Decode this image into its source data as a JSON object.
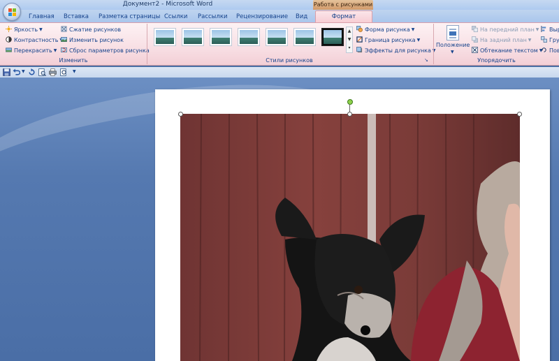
{
  "window": {
    "title": "Документ2 - Microsoft Word",
    "context_tab_group": "Работа с рисунками"
  },
  "tabs": [
    {
      "label": "Главная"
    },
    {
      "label": "Вставка"
    },
    {
      "label": "Разметка страницы"
    },
    {
      "label": "Ссылки"
    },
    {
      "label": "Рассылки"
    },
    {
      "label": "Рецензирование"
    },
    {
      "label": "Вид"
    },
    {
      "label": "Формат",
      "active": true
    }
  ],
  "ribbon": {
    "adjust": {
      "label": "Изменить",
      "brightness": "Яркость",
      "contrast": "Контрастность",
      "recolor": "Перекрасить",
      "compress": "Сжатие рисунков",
      "change": "Изменить рисунок",
      "reset": "Сброс параметров рисунка"
    },
    "styles": {
      "label": "Стили рисунков",
      "shape": "Форма рисунка",
      "border": "Граница рисунка",
      "effects": "Эффекты для рисунка",
      "thumb_count": 7,
      "selected_index": 6
    },
    "arrange": {
      "label": "Упорядочить",
      "position": "Положение",
      "bring_front": "На передний план",
      "send_back": "На задний план",
      "text_wrap": "Обтекание текстом",
      "align_cut": "Выр",
      "group_cut": "Гру",
      "rotate_cut": "Пов"
    }
  },
  "colors": {
    "ribbon_pink": "#f8dfe4",
    "context_orange": "#d29a6a",
    "workspace_blue": "#4a6ea6",
    "rotate_handle": "#8ed14b"
  },
  "icons": {
    "office": "office-logo-icon",
    "save": "save-icon",
    "undo": "undo-icon",
    "redo": "redo-icon",
    "print_preview": "print-preview-icon",
    "print": "print-icon",
    "zoom": "magnifier-icon",
    "customize": "chevron-down-icon"
  }
}
